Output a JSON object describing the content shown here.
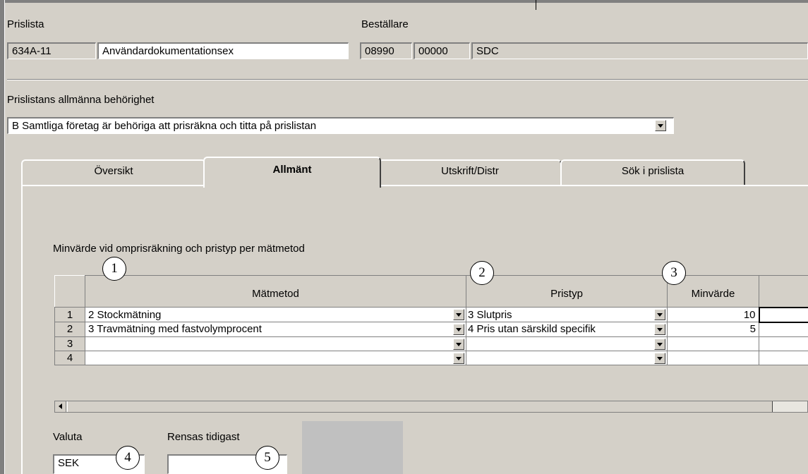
{
  "header": {
    "prislista_label": "Prislista",
    "prislista_code": "634A-11",
    "prislista_name": "Användardokumentationsex",
    "bestallare_label": "Beställare",
    "bestallare_code1": "08990",
    "bestallare_code2": "00000",
    "bestallare_name": "SDC"
  },
  "behorighet": {
    "label": "Prislistans allmänna behörighet",
    "value": "B Samtliga företag är behöriga att prisräkna och titta på prislistan"
  },
  "tabs": [
    {
      "label": "Översikt",
      "active": false
    },
    {
      "label": "Allmänt",
      "active": true
    },
    {
      "label": "Utskrift/Distr",
      "active": false
    },
    {
      "label": "Sök i prislista",
      "active": false
    }
  ],
  "grid": {
    "title": "Minvärde vid omprisräkning och pristyp per mätmetod",
    "columns": [
      "Mätmetod",
      "Pristyp",
      "Minvärde"
    ],
    "rows": [
      {
        "num": "1",
        "matmetod": "2 Stockmätning",
        "pristyp": "3 Slutpris",
        "minvarde": "10"
      },
      {
        "num": "2",
        "matmetod": "3 Travmätning med fastvolymprocent",
        "pristyp": "4 Pris utan särskild specifik",
        "minvarde": "5"
      },
      {
        "num": "3",
        "matmetod": "",
        "pristyp": "",
        "minvarde": ""
      },
      {
        "num": "4",
        "matmetod": "",
        "pristyp": "",
        "minvarde": ""
      }
    ]
  },
  "bottom": {
    "valuta_label": "Valuta",
    "valuta_value": "SEK",
    "rensas_label": "Rensas tidigast",
    "rensas_value": ""
  },
  "callouts": [
    "1",
    "2",
    "3",
    "4",
    "5"
  ]
}
